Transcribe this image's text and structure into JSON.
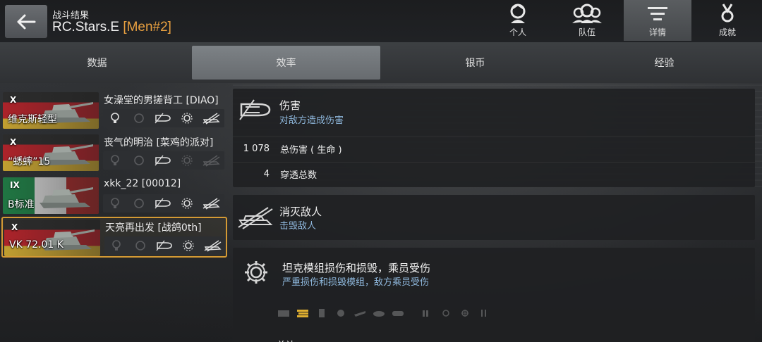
{
  "header": {
    "subtitle": "战斗结果",
    "player": "RC.Stars.E",
    "clan_tag": "[Men#2]",
    "nav": [
      {
        "label": "个人",
        "icon": "personal-icon"
      },
      {
        "label": "队伍",
        "icon": "team-icon"
      },
      {
        "label": "详情",
        "icon": "details-icon",
        "active": true
      },
      {
        "label": "成就",
        "icon": "achievements-icon"
      }
    ]
  },
  "tabs": [
    {
      "label": "数据"
    },
    {
      "label": "效率",
      "active": true
    },
    {
      "label": "银币"
    },
    {
      "label": "经验"
    }
  ],
  "players": [
    {
      "name": "女澡堂的男搓背工 [DIAO]",
      "tank": "维克斯轻型",
      "tier": "X",
      "nation": "de"
    },
    {
      "name": "丧气的明治 [菜鸡的派对]",
      "tank": "“蟋蟀”15",
      "tier": "X",
      "nation": "de"
    },
    {
      "name": "xkk_22 [00012]",
      "tank": "B标准",
      "tier": "IX",
      "nation": "it"
    },
    {
      "name": "天亮再出发 [战鸽0th]",
      "tank": "VK 72.01 K",
      "tier": "X",
      "nation": "de",
      "selected": true
    }
  ],
  "damage": {
    "title": "伤害",
    "subtitle": "对敌方造成伤害",
    "rows": [
      {
        "value": "1 078",
        "label": "总伤害 ( 生命 )"
      },
      {
        "value": "4",
        "label": "穿透总数"
      }
    ]
  },
  "kills": {
    "title": "消灭敌人",
    "subtitle": "击毁敌人"
  },
  "modules": {
    "title": "坦克模组损伤和损毁，乘员受伤",
    "subtitle": "严重损伤和损毁模组，敌方乘员受伤",
    "peek": "总计"
  },
  "colors": {
    "accent": "#d49a34",
    "subtitle_blue": "#8fb8dd",
    "active_tab": "#7d8286"
  }
}
